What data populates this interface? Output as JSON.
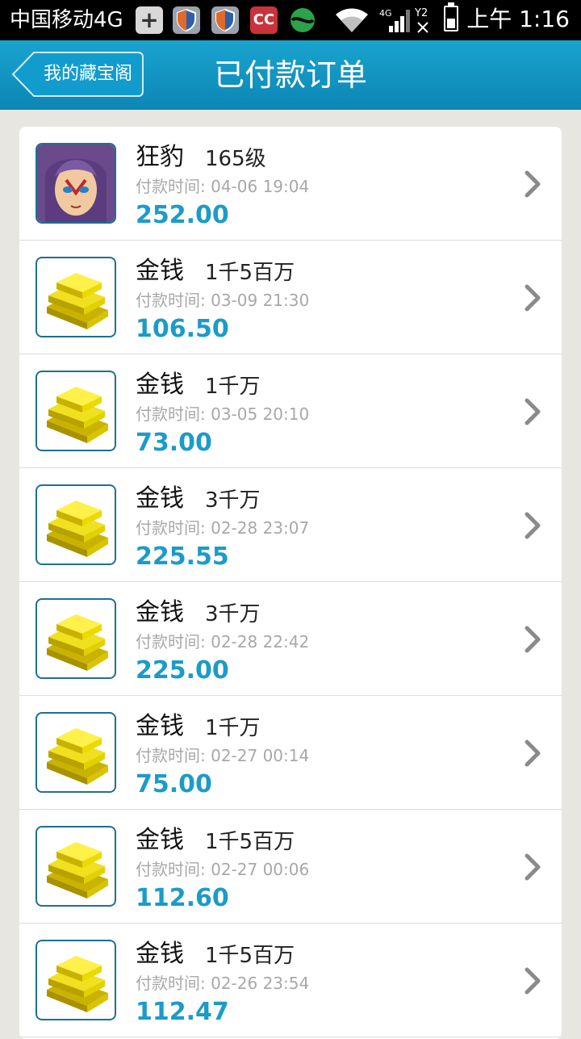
{
  "status_bar": {
    "carrier": "中国移动4G",
    "icons": [
      "plus-icon",
      "shield-icon",
      "shield-icon",
      "cc-icon",
      "ball-icon",
      "wifi-icon",
      "signal-4g-icon",
      "sim-icon",
      "battery-icon"
    ],
    "cc_label": "CC",
    "plus_label": "+",
    "time": "上午 1:16"
  },
  "header": {
    "back_label": "我的藏宝阁",
    "title": "已付款订单",
    "color": "#139acb"
  },
  "orders": [
    {
      "thumb": "character-avatar",
      "name": "狂豹",
      "qty": "165级",
      "time_label": "付款时间: ",
      "time": "04-06 19:04",
      "price": "252.00"
    },
    {
      "thumb": "gold-bars-icon",
      "name": "金钱",
      "qty": "1千5百万",
      "time_label": "付款时间: ",
      "time": "03-09 21:30",
      "price": "106.50"
    },
    {
      "thumb": "gold-bars-icon",
      "name": "金钱",
      "qty": "1千万",
      "time_label": "付款时间: ",
      "time": "03-05 20:10",
      "price": "73.00"
    },
    {
      "thumb": "gold-bars-icon",
      "name": "金钱",
      "qty": "3千万",
      "time_label": "付款时间: ",
      "time": "02-28 23:07",
      "price": "225.55"
    },
    {
      "thumb": "gold-bars-icon",
      "name": "金钱",
      "qty": "3千万",
      "time_label": "付款时间: ",
      "time": "02-28 22:42",
      "price": "225.00"
    },
    {
      "thumb": "gold-bars-icon",
      "name": "金钱",
      "qty": "1千万",
      "time_label": "付款时间: ",
      "time": "02-27 00:14",
      "price": "75.00"
    },
    {
      "thumb": "gold-bars-icon",
      "name": "金钱",
      "qty": "1千5百万",
      "time_label": "付款时间: ",
      "time": "02-27 00:06",
      "price": "112.60"
    },
    {
      "thumb": "gold-bars-icon",
      "name": "金钱",
      "qty": "1千5百万",
      "time_label": "付款时间: ",
      "time": "02-26 23:54",
      "price": "112.47"
    }
  ],
  "colors": {
    "price": "#1c9bc8",
    "accent": "#139acb",
    "background": "#e8e6e1"
  }
}
